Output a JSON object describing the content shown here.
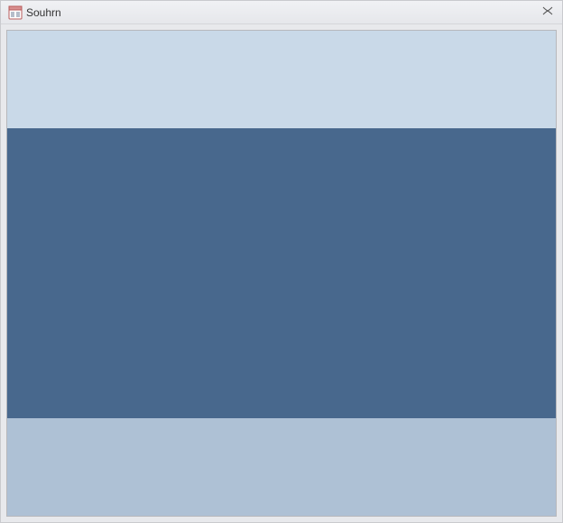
{
  "window": {
    "title": "Souhrn",
    "icon_name": "form-icon"
  },
  "colors": {
    "band_top": "#c9d9e8",
    "band_middle": "#48688d",
    "band_bottom": "#aec1d5"
  }
}
